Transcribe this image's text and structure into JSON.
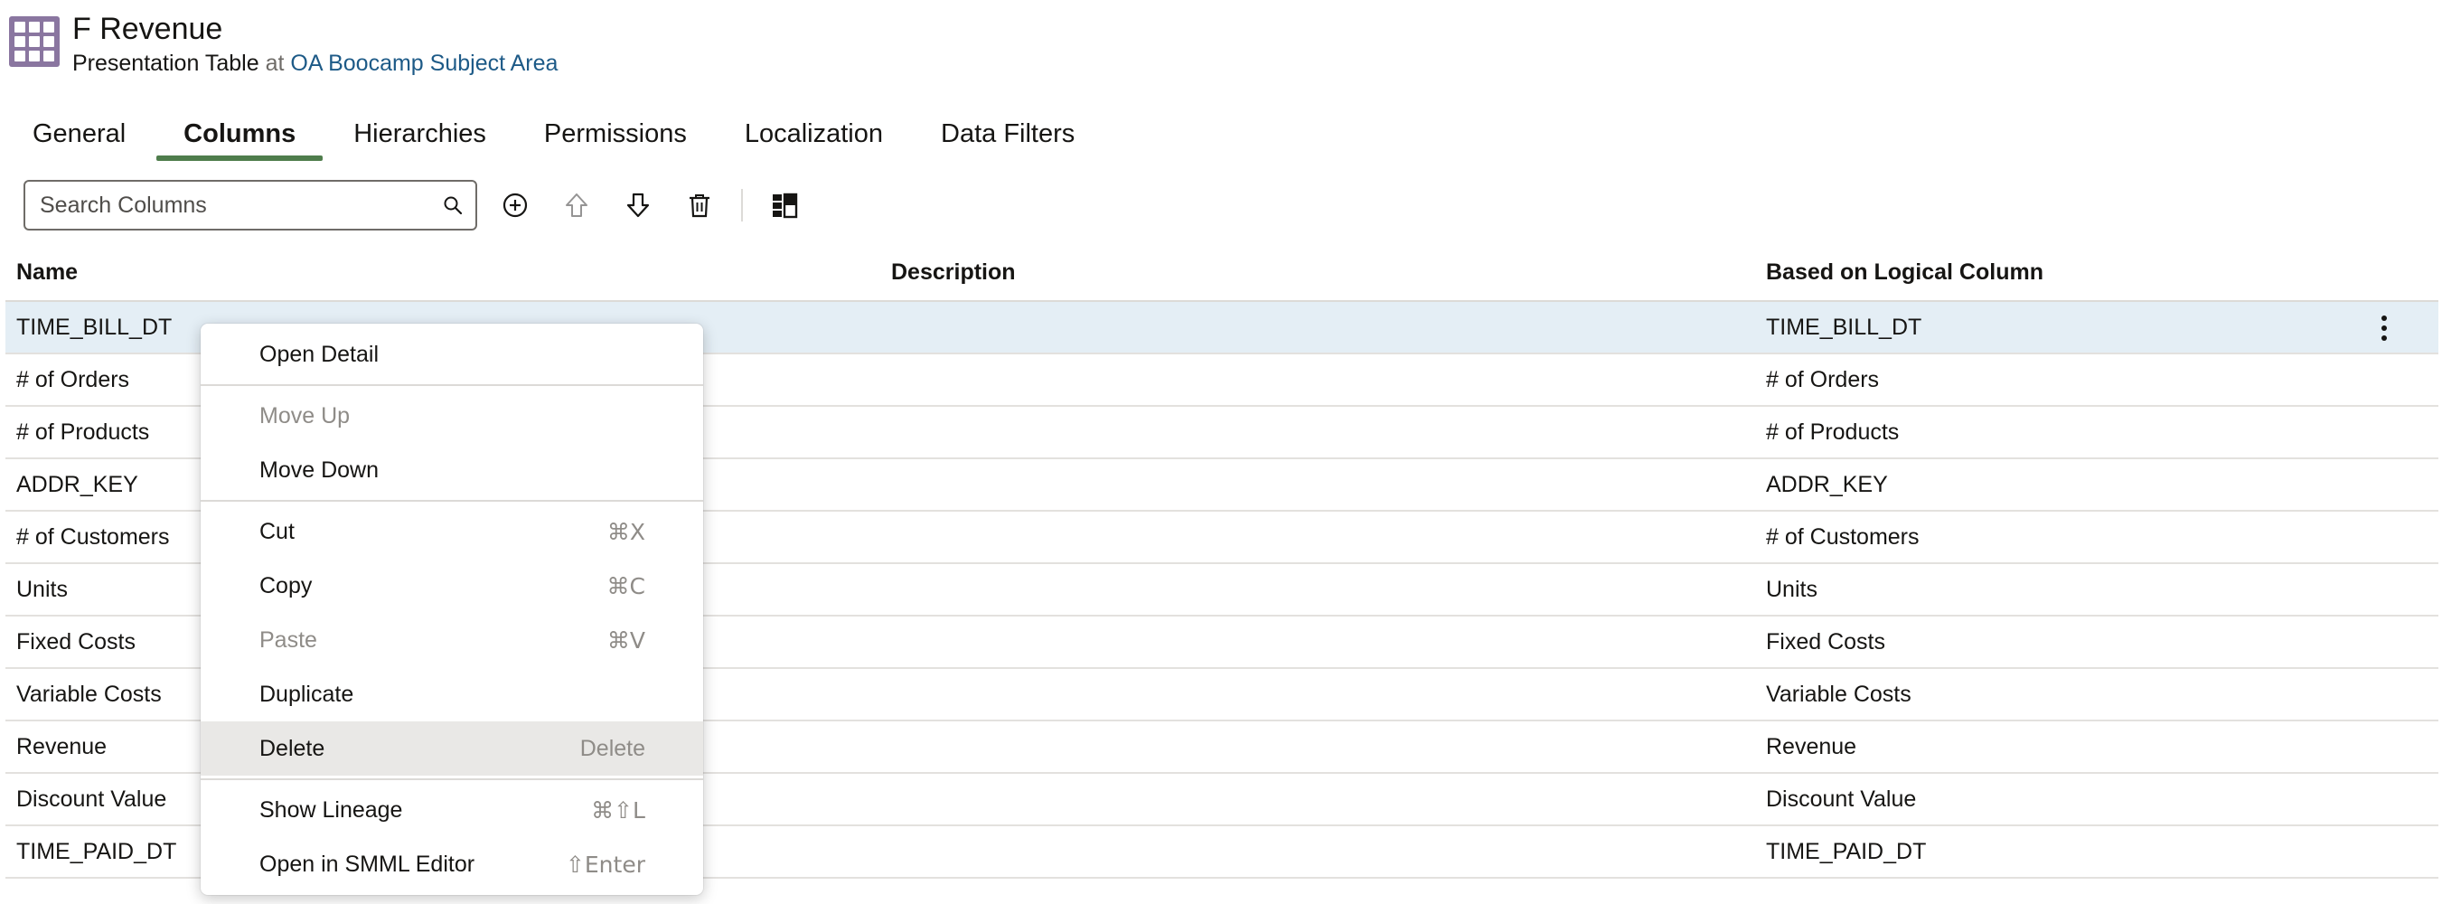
{
  "header": {
    "title": "F Revenue",
    "subtitle_type": "Presentation Table",
    "subtitle_at": "at",
    "subtitle_link": "OA Boocamp Subject Area",
    "icon": "grid-table-icon",
    "icon_color": "#8a76a0"
  },
  "tabs": [
    {
      "label": "General"
    },
    {
      "label": "Columns"
    },
    {
      "label": "Hierarchies"
    },
    {
      "label": "Permissions"
    },
    {
      "label": "Localization"
    },
    {
      "label": "Data Filters"
    }
  ],
  "active_tab": "Columns",
  "toolbar": {
    "search_placeholder": "Search Columns",
    "buttons": [
      "add-icon",
      "move-up-icon",
      "move-down-icon",
      "delete-icon",
      "column-layout-icon"
    ]
  },
  "table": {
    "headers": {
      "name": "Name",
      "description": "Description",
      "logical": "Based on Logical Column"
    },
    "rows": [
      {
        "name": "TIME_BILL_DT",
        "description": "",
        "logical": "TIME_BILL_DT"
      },
      {
        "name": "# of Orders",
        "description": "",
        "logical": "# of Orders"
      },
      {
        "name": "# of Products",
        "description": "",
        "logical": "# of Products"
      },
      {
        "name": "ADDR_KEY",
        "description": "",
        "logical": "ADDR_KEY"
      },
      {
        "name": "# of Customers",
        "description": "",
        "logical": "# of Customers"
      },
      {
        "name": "Units",
        "description": "",
        "logical": "Units"
      },
      {
        "name": "Fixed Costs",
        "description": "",
        "logical": "Fixed Costs"
      },
      {
        "name": "Variable Costs",
        "description": "",
        "logical": "Variable Costs"
      },
      {
        "name": "Revenue",
        "description": "",
        "logical": "Revenue"
      },
      {
        "name": "Discount Value",
        "description": "",
        "logical": "Discount Value"
      },
      {
        "name": "TIME_PAID_DT",
        "description": "",
        "logical": "TIME_PAID_DT"
      }
    ]
  },
  "context_menu": {
    "open_detail": {
      "label": "Open Detail"
    },
    "move_up": {
      "label": "Move Up"
    },
    "move_down": {
      "label": "Move Down"
    },
    "cut": {
      "label": "Cut",
      "shortcut": "⌘X"
    },
    "copy": {
      "label": "Copy",
      "shortcut": "⌘C"
    },
    "paste": {
      "label": "Paste",
      "shortcut": "⌘V"
    },
    "duplicate": {
      "label": "Duplicate"
    },
    "delete": {
      "label": "Delete",
      "shortcut": "Delete"
    },
    "show_lineage": {
      "label": "Show Lineage",
      "shortcut": "⌘⇧L"
    },
    "open_smml": {
      "label": "Open in SMML Editor",
      "shortcut": "⇧Enter"
    }
  }
}
